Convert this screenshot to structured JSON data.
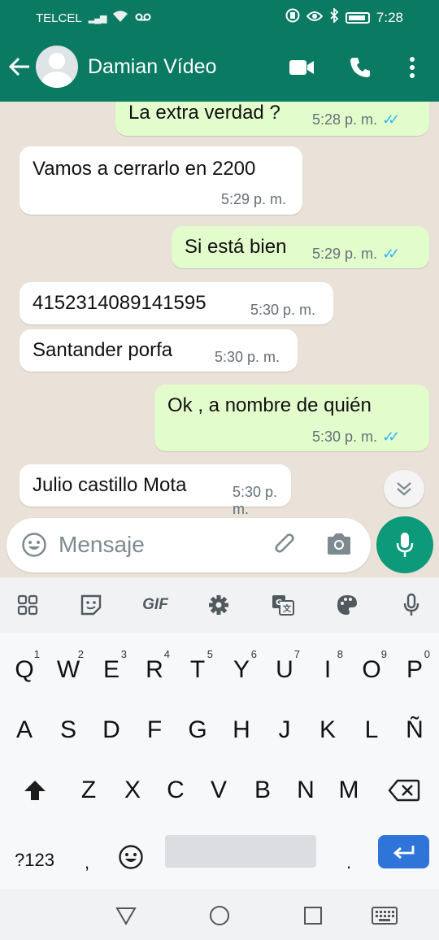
{
  "status_bar": {
    "carrier": "TELCEL",
    "time": "7:28"
  },
  "header": {
    "contact_name": "Damian Vídeo",
    "icons": [
      "back-arrow-icon",
      "avatar",
      "video-call-icon",
      "phone-icon",
      "more-vert-icon"
    ]
  },
  "messages": [
    {
      "direction": "out",
      "text": "La extra verdad ?",
      "time": "5:28 p. m.",
      "read": true
    },
    {
      "direction": "in",
      "text": "Vamos a cerrarlo en 2200",
      "time": "5:29 p. m."
    },
    {
      "direction": "out",
      "text": "Si está bien",
      "time": "5:29 p. m.",
      "read": true
    },
    {
      "direction": "in",
      "text": "4152314089141595",
      "time": "5:30 p. m."
    },
    {
      "direction": "in",
      "text": "Santander porfa",
      "time": "5:30 p. m."
    },
    {
      "direction": "out",
      "text": "Ok , a nombre de quién",
      "time": "5:30 p. m.",
      "read": true
    },
    {
      "direction": "in",
      "text": "Julio castillo Mota",
      "time": "5:30 p. m."
    }
  ],
  "composer": {
    "placeholder": "Mensaje"
  },
  "keyboard": {
    "toolbar": {
      "gif_label": "GIF"
    },
    "row1": [
      {
        "key": "Q",
        "num": "1"
      },
      {
        "key": "W",
        "num": "2"
      },
      {
        "key": "E",
        "num": "3"
      },
      {
        "key": "R",
        "num": "4"
      },
      {
        "key": "T",
        "num": "5"
      },
      {
        "key": "Y",
        "num": "6"
      },
      {
        "key": "U",
        "num": "7"
      },
      {
        "key": "I",
        "num": "8"
      },
      {
        "key": "O",
        "num": "9"
      },
      {
        "key": "P",
        "num": "0"
      }
    ],
    "row2": [
      "A",
      "S",
      "D",
      "F",
      "G",
      "H",
      "J",
      "K",
      "L",
      "Ñ"
    ],
    "row3": [
      "Z",
      "X",
      "C",
      "V",
      "B",
      "N",
      "M"
    ],
    "bottom": {
      "symbols": "?123",
      "comma": ",",
      "period": "."
    }
  },
  "colors": {
    "header": "#0b7a62",
    "outgoing_bubble": "#e3fccc",
    "incoming_bubble": "#ffffff",
    "mic_button": "#0c9a7a",
    "enter_key": "#2f74d8",
    "read_ticks": "#34b7f1"
  }
}
